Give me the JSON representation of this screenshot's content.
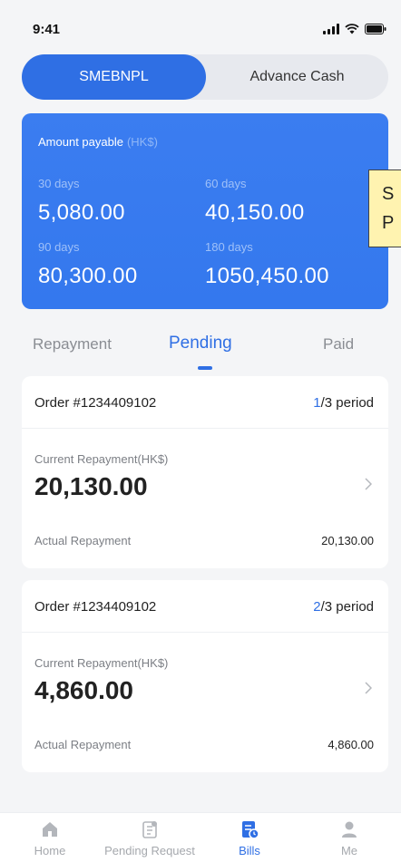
{
  "status_bar": {
    "time": "9:41"
  },
  "toggle": {
    "active": "SMEBNPL",
    "inactive": "Advance Cash"
  },
  "summary": {
    "title": "Amount payable",
    "unit": "(HK$)",
    "periods": [
      {
        "label": "30 days",
        "value": "5,080.00"
      },
      {
        "label": "60 days",
        "value": "40,150.00"
      },
      {
        "label": "90 days",
        "value": "80,300.00"
      },
      {
        "label": "180 days",
        "value": "1050,450.00"
      }
    ]
  },
  "overlay_note": {
    "line1": "S",
    "line2": "P"
  },
  "tabs": [
    {
      "label": "Repayment"
    },
    {
      "label": "Pending"
    },
    {
      "label": "Paid"
    }
  ],
  "orders": [
    {
      "order_no": "Order #1234409102",
      "current_period": "1",
      "period_suffix": "/3 period",
      "current_label": "Current Repayment(HK$)",
      "current_amount": "20,130.00",
      "actual_label": "Actual Repayment",
      "actual_value": "20,130.00"
    },
    {
      "order_no": "Order #1234409102",
      "current_period": "2",
      "period_suffix": "/3 period",
      "current_label": "Current Repayment(HK$)",
      "current_amount": "4,860.00",
      "actual_label": "Actual Repayment",
      "actual_value": "4,860.00"
    }
  ],
  "bottom_nav": [
    {
      "label": "Home",
      "icon": "home-icon"
    },
    {
      "label": "Pending Request",
      "icon": "pending-request-icon"
    },
    {
      "label": "Bills",
      "icon": "bills-icon"
    },
    {
      "label": "Me",
      "icon": "user-icon"
    }
  ],
  "colors": {
    "accent": "#2f6fe4",
    "card_blue": "#3478ee",
    "background": "#f4f5f7"
  }
}
